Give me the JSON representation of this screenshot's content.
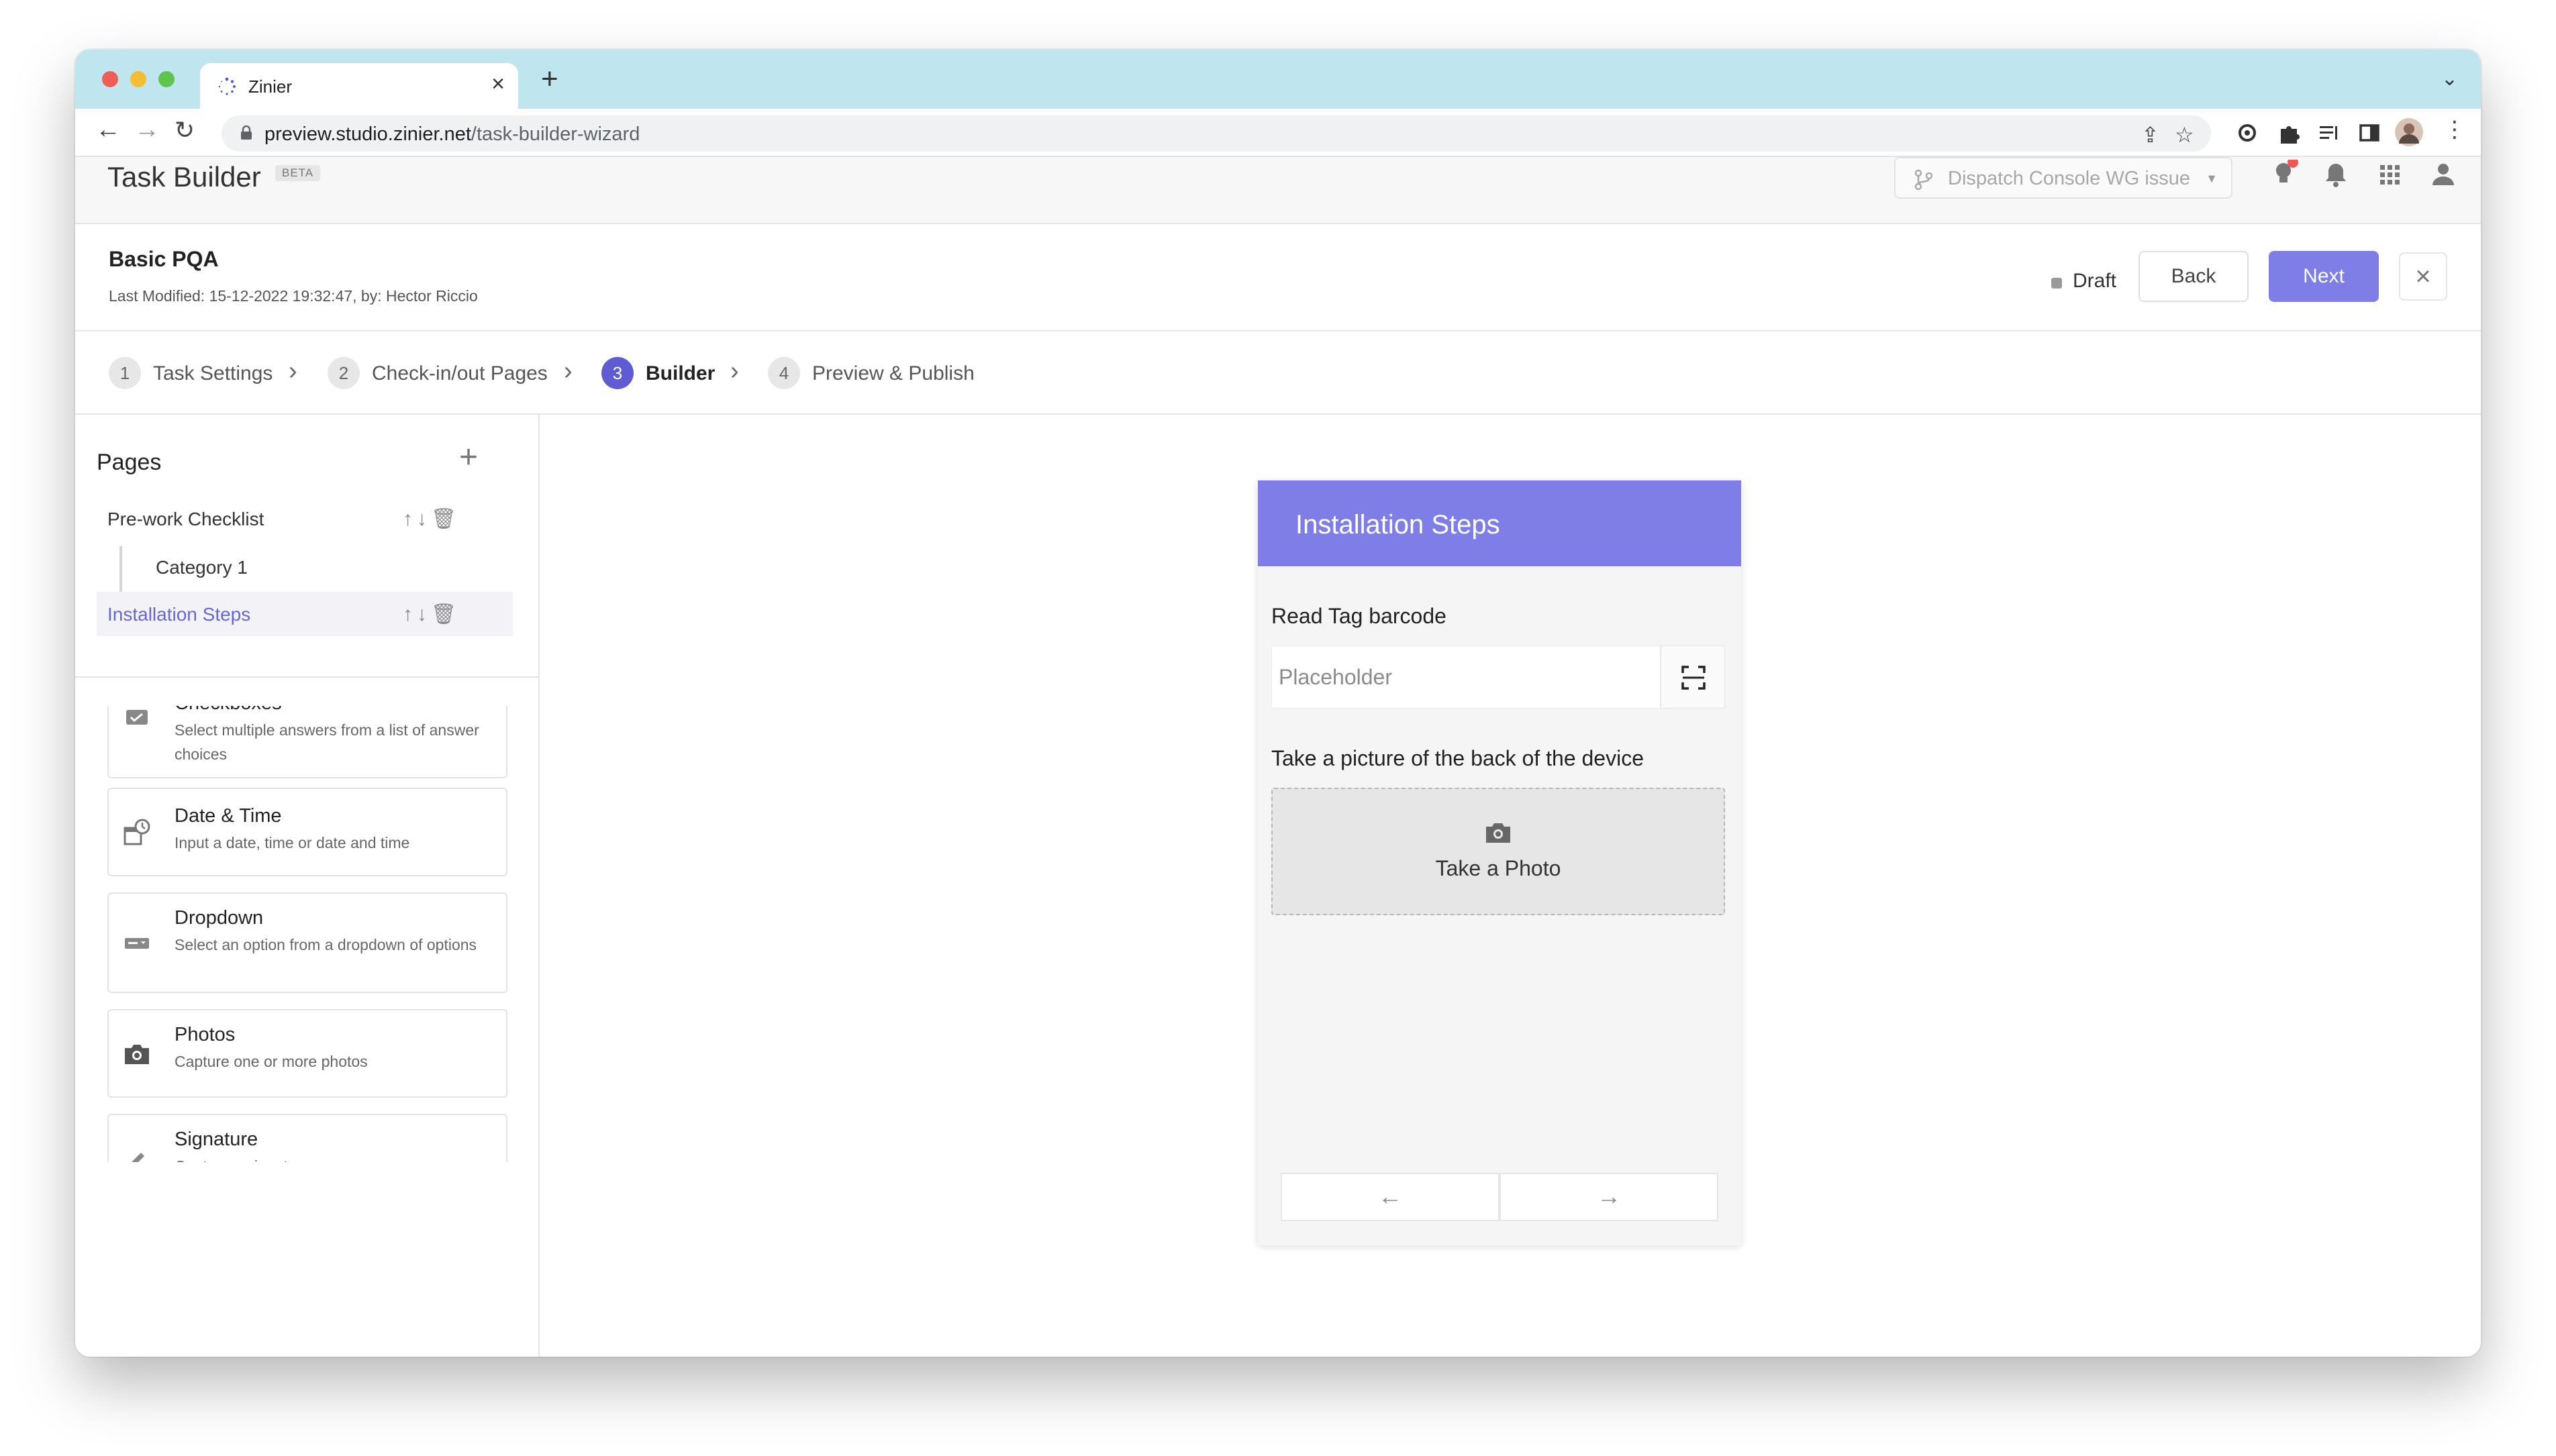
{
  "browser": {
    "tab_title": "Zinier",
    "new_tab": "+",
    "url_host": "preview.studio.zinier.net",
    "url_path": "/task-builder-wizard"
  },
  "app": {
    "title": "Task Builder",
    "beta_badge": "BETA",
    "workspace_selector": "Dispatch Console WG issue"
  },
  "task": {
    "name": "Basic PQA",
    "last_modified": "Last Modified: 15-12-2022 19:32:47, by: Hector Riccio",
    "status": "Draft",
    "back_label": "Back",
    "next_label": "Next"
  },
  "steps": [
    {
      "num": "1",
      "label": "Task Settings"
    },
    {
      "num": "2",
      "label": "Check-in/out Pages"
    },
    {
      "num": "3",
      "label": "Builder"
    },
    {
      "num": "4",
      "label": "Preview & Publish"
    }
  ],
  "pages_panel": {
    "title": "Pages",
    "pages": [
      {
        "label": "Pre-work Checklist"
      },
      {
        "label": "Category 1"
      },
      {
        "label": "Installation Steps"
      }
    ]
  },
  "palette": [
    {
      "title": "Checkboxes",
      "desc": "Select multiple answers from a list of answer choices",
      "icon": "checkbox-icon"
    },
    {
      "title": "Date & Time",
      "desc": "Input a date, time or date and time",
      "icon": "date-time-icon"
    },
    {
      "title": "Dropdown",
      "desc": "Select an option from a dropdown of options",
      "icon": "dropdown-icon"
    },
    {
      "title": "Photos",
      "desc": "Capture one or more photos",
      "icon": "camera-icon"
    },
    {
      "title": "Signature",
      "desc": "Capture a signature",
      "icon": "signature-icon"
    }
  ],
  "preview": {
    "page_title": "Installation Steps",
    "q1_label": "Read Tag barcode",
    "q1_placeholder": "Placeholder",
    "q2_label": "Take a picture of the back of the device",
    "photo_button": "Take a Photo",
    "prev_arrow": "←",
    "next_arrow": "→"
  },
  "colors": {
    "accent": "#7f7ee6",
    "active_step": "#5f5bd3",
    "selected_page_text": "#6866d6"
  }
}
